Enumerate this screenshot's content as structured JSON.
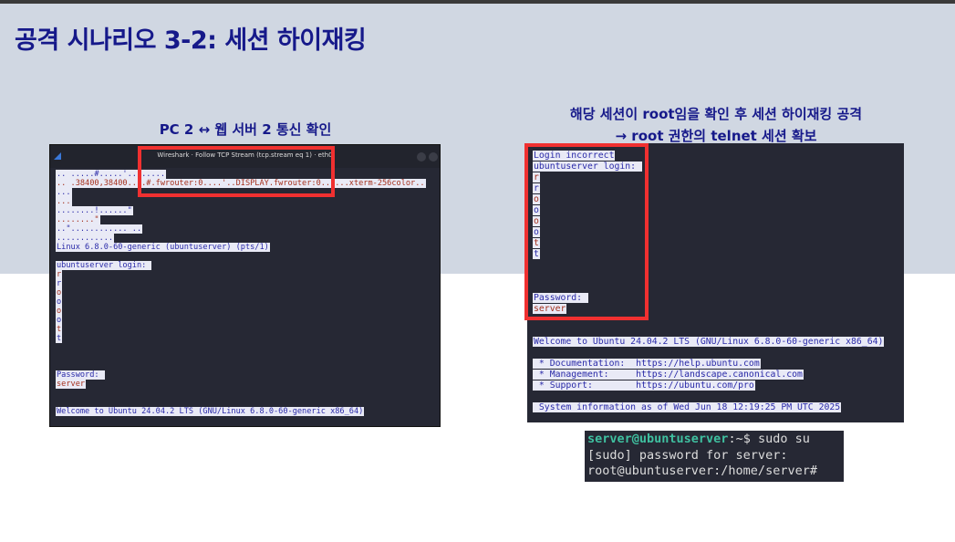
{
  "title": "공격 시나리오 3-2: 세션 하이재킹",
  "left": {
    "caption": "PC 2 ↔ 웹 서버 2 통신 확인",
    "window_title": "Wireshark · Follow TCP Stream (tcp.stream eq 1) · eth0",
    "lines": [
      {
        "text": ".. .....#.....'........",
        "color": "blue"
      },
      {
        "text": ".. .38400,38400....#.fwrouter:0....'..DISPLAY.fwrouter:0......xterm-256color..",
        "color": "red"
      },
      {
        "text": "...",
        "color": "blue"
      },
      {
        "text": "...",
        "color": "red"
      },
      {
        "text": "........!......\"",
        "color": "blue"
      },
      {
        "text": "........\"",
        "color": "red"
      },
      {
        "text": "..\"............ ..",
        "color": "blue"
      },
      {
        "text": "............",
        "color": "blue"
      },
      {
        "text": "Linux 6.8.0-60-generic (ubuntuserver) (pts/1)",
        "color": "blue"
      },
      {
        "text": "",
        "color": "blue"
      },
      {
        "text": "ubuntuserver login: ",
        "color": "blue"
      },
      {
        "text": "r",
        "color": "red"
      },
      {
        "text": "r",
        "color": "blue"
      },
      {
        "text": "o",
        "color": "red"
      },
      {
        "text": "o",
        "color": "blue"
      },
      {
        "text": "o",
        "color": "red"
      },
      {
        "text": "o",
        "color": "blue"
      },
      {
        "text": "t",
        "color": "red"
      },
      {
        "text": "t",
        "color": "blue"
      },
      {
        "text": "",
        "color": "blue"
      },
      {
        "text": "",
        "color": "blue"
      },
      {
        "text": "",
        "color": "blue"
      },
      {
        "text": "Password: ",
        "color": "blue"
      },
      {
        "text": "server",
        "color": "red"
      },
      {
        "text": "",
        "color": "blue"
      },
      {
        "text": "",
        "color": "blue"
      },
      {
        "text": "Welcome to Ubuntu 24.04.2 LTS (GNU/Linux 6.8.0-60-generic x86_64)",
        "color": "blue"
      }
    ]
  },
  "right": {
    "caption_line1": "해당 세션이 root임을 확인 후 세션 하이재킹 공격",
    "caption_line2": "→ root 권한의 telnet 세션 확보",
    "lines": [
      {
        "text": "Login incorrect",
        "color": "blue"
      },
      {
        "text": "ubuntuserver login: ",
        "color": "blue"
      },
      {
        "text": "r",
        "color": "red"
      },
      {
        "text": "r",
        "color": "blue"
      },
      {
        "text": "o",
        "color": "red"
      },
      {
        "text": "o",
        "color": "blue"
      },
      {
        "text": "o",
        "color": "red"
      },
      {
        "text": "o",
        "color": "blue"
      },
      {
        "text": "t",
        "color": "red"
      },
      {
        "text": "t",
        "color": "blue"
      },
      {
        "text": "",
        "color": "blue"
      },
      {
        "text": "",
        "color": "blue"
      },
      {
        "text": "",
        "color": "blue"
      },
      {
        "text": "Password: ",
        "color": "blue"
      },
      {
        "text": "server",
        "color": "red"
      },
      {
        "text": "",
        "color": "blue"
      },
      {
        "text": "",
        "color": "blue"
      },
      {
        "text": "Welcome to Ubuntu 24.04.2 LTS (GNU/Linux 6.8.0-60-generic x86_64)",
        "color": "blue"
      },
      {
        "text": "",
        "color": "blue"
      },
      {
        "text": " * Documentation:  https://help.ubuntu.com",
        "color": "blue"
      },
      {
        "text": " * Management:     https://landscape.canonical.com",
        "color": "blue"
      },
      {
        "text": " * Support:        https://ubuntu.com/pro",
        "color": "blue"
      },
      {
        "text": "",
        "color": "blue"
      },
      {
        "text": " System information as of Wed Jun 18 12:19:25 PM UTC 2025",
        "color": "blue"
      }
    ]
  },
  "shell": {
    "prompt_user": "server@ubuntuserver",
    "prompt_rest": ":~$ sudo su",
    "line2": "[sudo] password for server:",
    "line3": "root@ubuntuserver:/home/server#"
  },
  "colors": {
    "accent": "#16198a",
    "highlight": "#f03030",
    "terminal_bg": "#262834"
  }
}
